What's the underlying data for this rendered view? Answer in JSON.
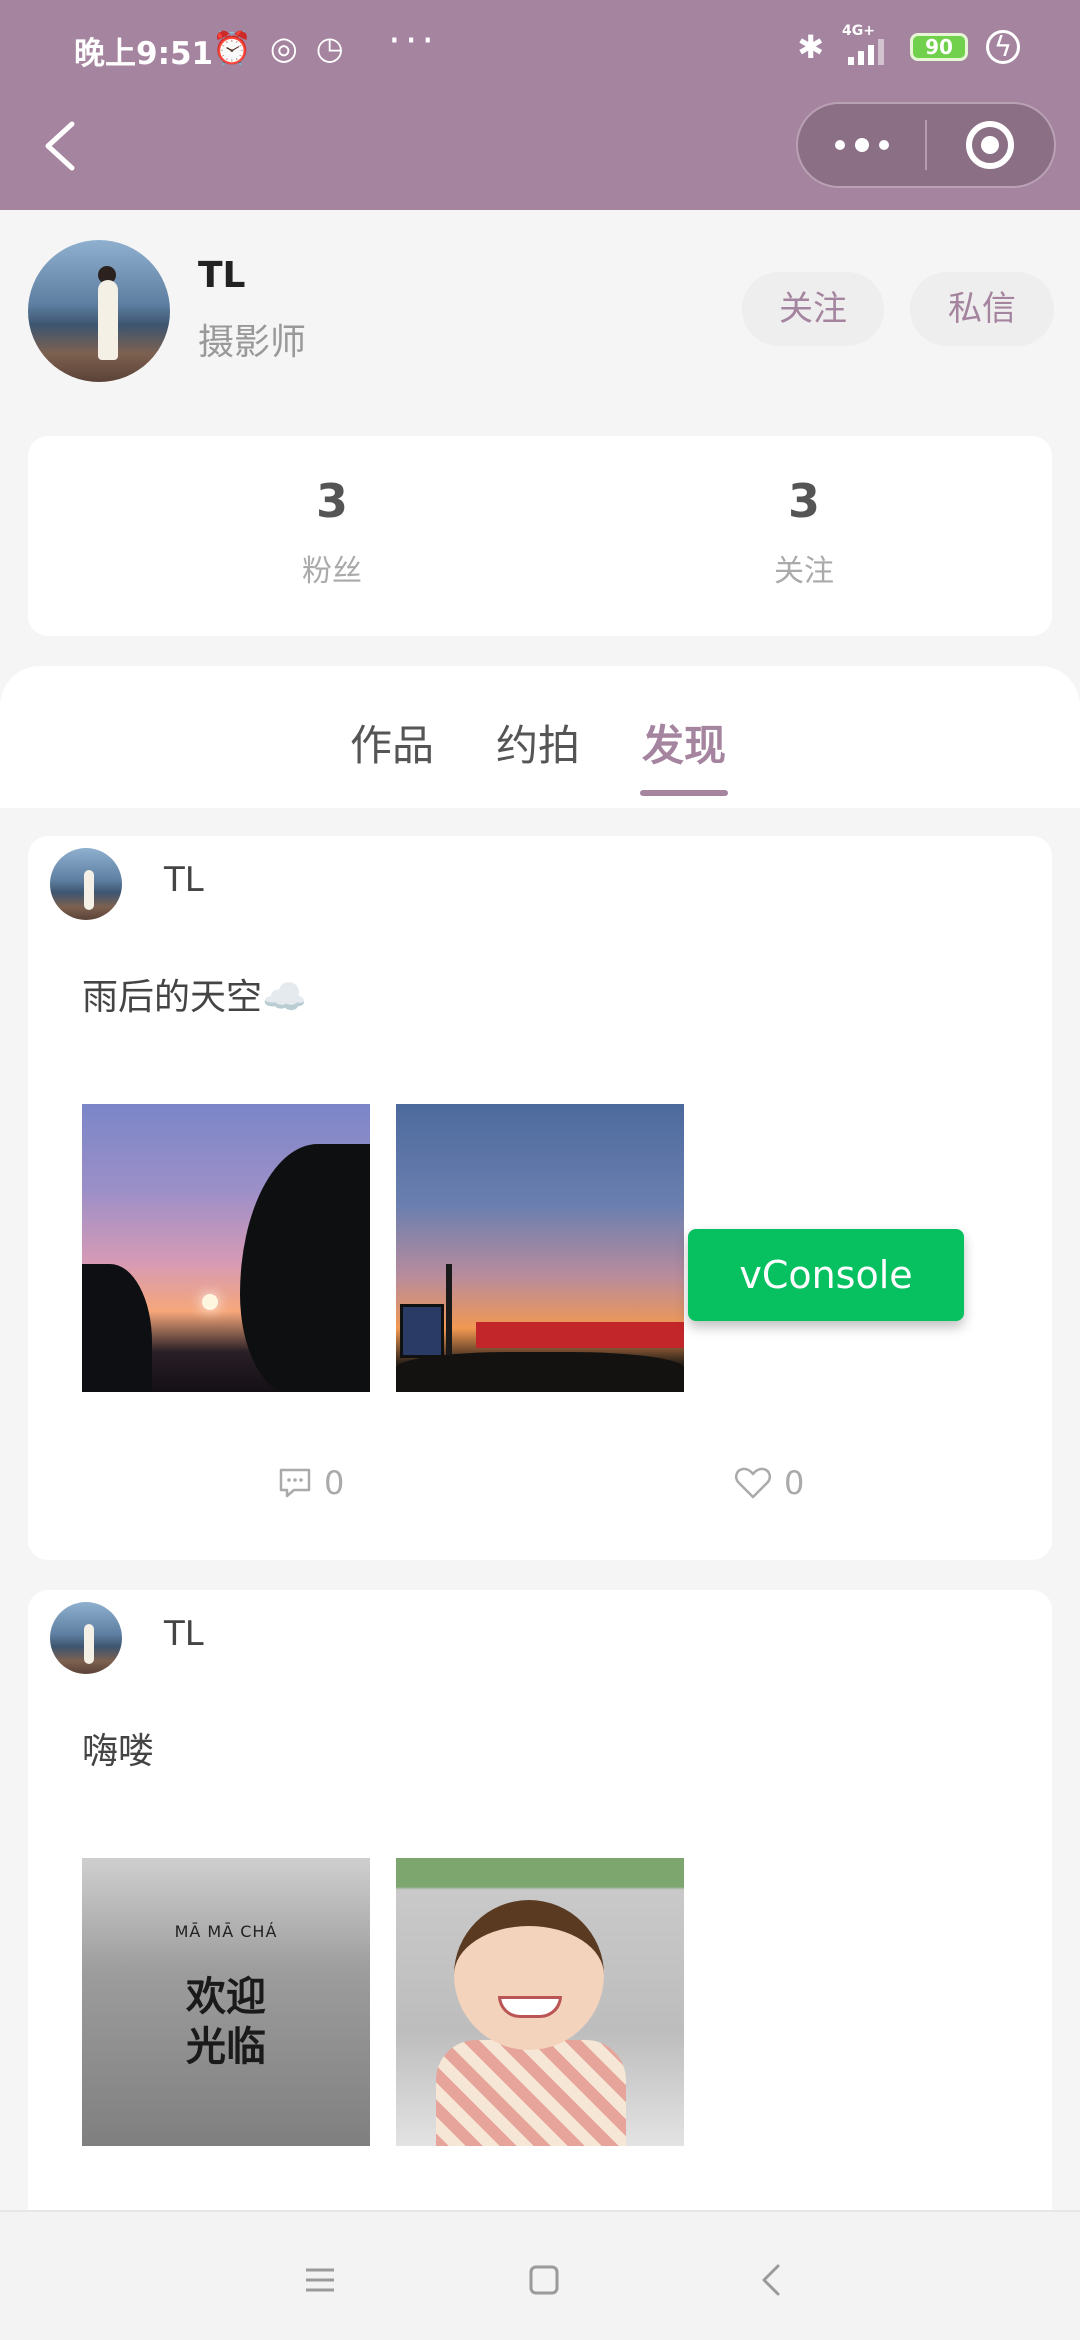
{
  "status_bar": {
    "time": "晚上9:51",
    "network_label": "4G+",
    "battery": "90"
  },
  "profile": {
    "name": "TL",
    "role": "摄影师",
    "follow_button": "关注",
    "message_button": "私信"
  },
  "stats": [
    {
      "value": "3",
      "label": "粉丝"
    },
    {
      "value": "3",
      "label": "关注"
    }
  ],
  "tabs": [
    "作品",
    "约拍",
    "发现"
  ],
  "active_tab": "发现",
  "posts": [
    {
      "author": "TL",
      "text": "雨后的天空☁️",
      "comments": "0",
      "likes": "0"
    },
    {
      "author": "TL",
      "text": "嗨喽",
      "photo_sign_brand": "MĀ MĀ CHÁ",
      "photo_sign_text_1": "欢迎",
      "photo_sign_text_2": "光临"
    }
  ],
  "vconsole_label": "vConsole",
  "colors": {
    "accent": "#a5849f",
    "vconsole": "#07c160"
  }
}
